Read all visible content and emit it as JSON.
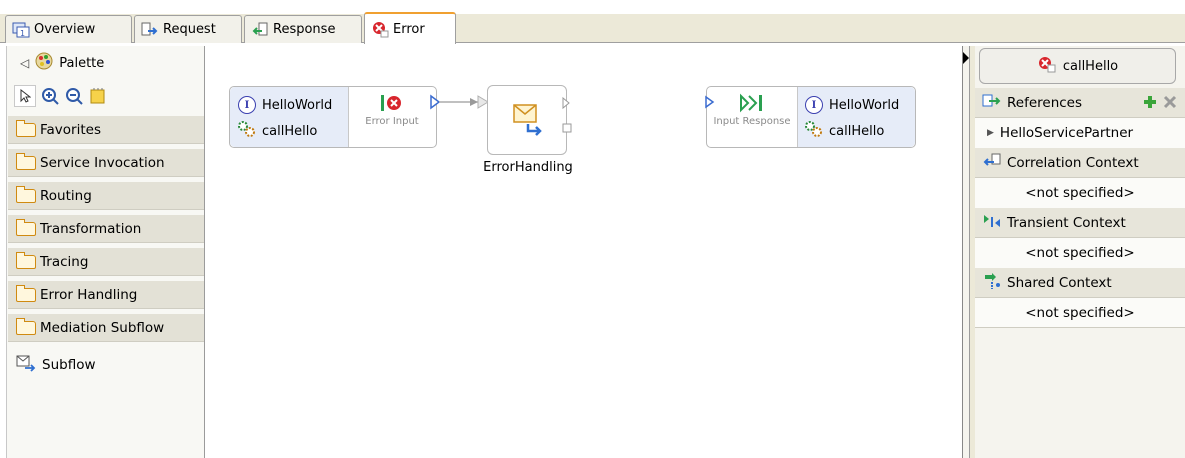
{
  "tabs": [
    {
      "label": "Overview",
      "icon": "overview-icon",
      "active": false
    },
    {
      "label": "Request",
      "icon": "request-icon",
      "active": false
    },
    {
      "label": "Response",
      "icon": "response-icon",
      "active": false
    },
    {
      "label": "Error",
      "icon": "error-icon",
      "active": true
    }
  ],
  "palette": {
    "title": "Palette",
    "drawers": [
      "Favorites",
      "Service Invocation",
      "Routing",
      "Transformation",
      "Tracing",
      "Error Handling",
      "Mediation Subflow"
    ],
    "item": "Subflow"
  },
  "canvas": {
    "source_node": {
      "interface": "HelloWorld",
      "operation": "callHello",
      "terminal": "Error Input"
    },
    "primitive": {
      "label": "ErrorHandling"
    },
    "target_node": {
      "terminal": "Input Response",
      "interface": "HelloWorld",
      "operation": "callHello"
    }
  },
  "right_panel": {
    "operation_button": "callHello",
    "sections": [
      {
        "label": "References",
        "value": "HelloServicePartner"
      },
      {
        "label": "Correlation Context",
        "value": "<not specified>"
      },
      {
        "label": "Transient Context",
        "value": "<not specified>"
      },
      {
        "label": "Shared Context",
        "value": "<not specified>"
      }
    ]
  },
  "colors": {
    "active_tab_accent": "#f0a030",
    "interface_blue": "#3b40b0",
    "error_red": "#d8262d",
    "folder_orange": "#d08a10",
    "add_green": "#3aa53a"
  }
}
